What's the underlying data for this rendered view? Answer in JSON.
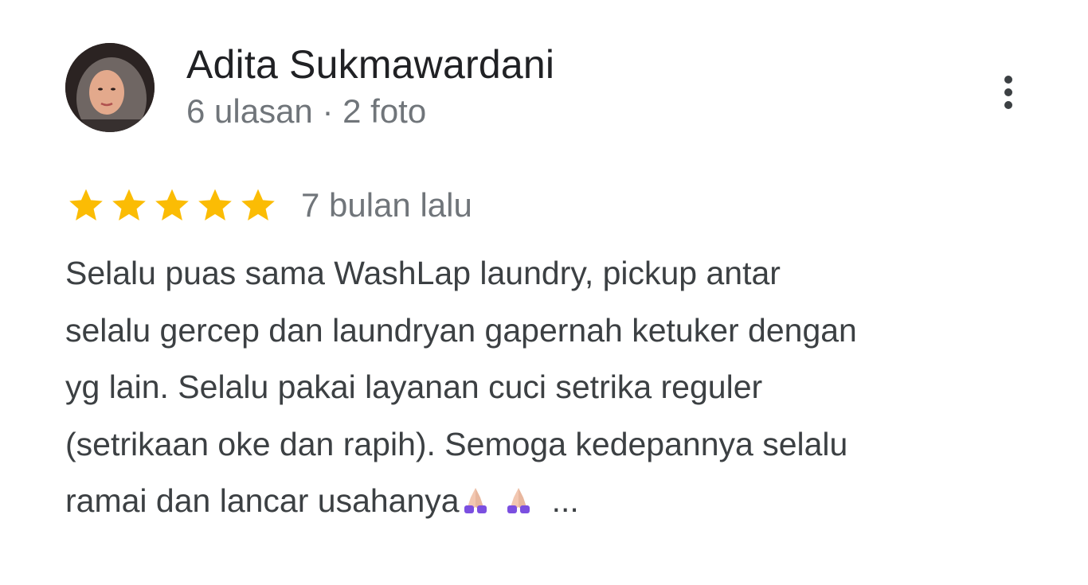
{
  "reviewer": {
    "name": "Adita Sukmawardani",
    "meta": "6 ulasan · 2 foto",
    "avatar_icon": "user-photo"
  },
  "rating": {
    "stars": 5,
    "max": 5,
    "star_color": "#fbbc04",
    "time": "7 bulan lalu"
  },
  "review": {
    "lines": [
      "Selalu puas sama WashLap laundry, pickup antar",
      "selalu gercep dan laundryan gapernah ketuker dengan",
      "yg lain. Selalu pakai layanan cuci setrika reguler",
      "(setrikaan oke dan rapih). Semoga kedepannya selalu",
      "ramai dan lancar usahanya"
    ],
    "emoji_icon": "folded-hands-icon",
    "more_label": "..."
  },
  "menu": {
    "icon": "more-vert-icon"
  }
}
